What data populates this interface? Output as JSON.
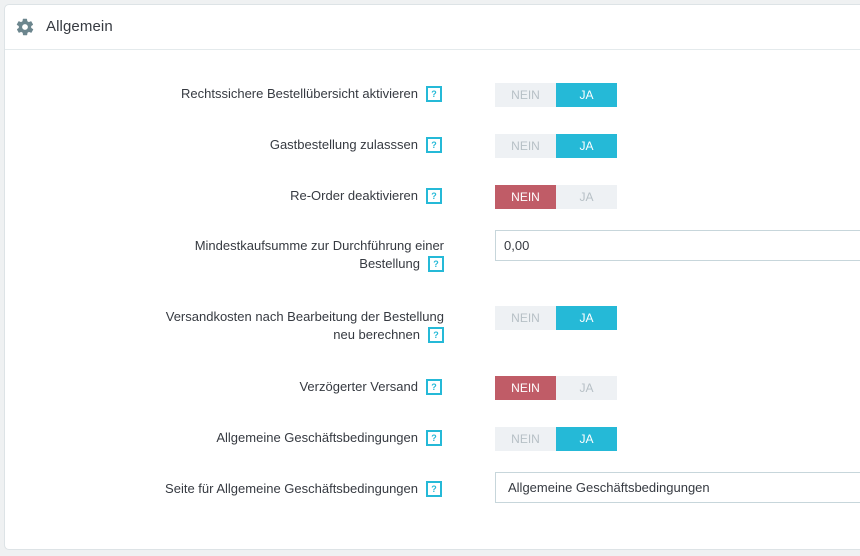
{
  "panel": {
    "title": "Allgemein",
    "icon": "gear-icon"
  },
  "help_mark": "?",
  "rows": [
    {
      "label": "Rechtssichere Bestellübersicht aktivieren",
      "type": "switch",
      "off": "NEIN",
      "on": "JA",
      "value": "JA"
    },
    {
      "label": "Gastbestellung zulasssen",
      "type": "switch",
      "off": "NEIN",
      "on": "JA",
      "value": "JA"
    },
    {
      "label": "Re-Order deaktivieren",
      "type": "switch",
      "off": "NEIN",
      "on": "JA",
      "value": "NEIN"
    },
    {
      "label_line1": "Mindestkaufsumme zur Durchführung einer",
      "label_line2": "Bestellung",
      "type": "input",
      "value": "0,00"
    },
    {
      "label_line1": "Versandkosten nach Bearbeitung der Bestellung",
      "label_line2": "neu berechnen",
      "type": "switch",
      "off": "NEIN",
      "on": "JA",
      "value": "JA"
    },
    {
      "label": "Verzögerter Versand",
      "type": "switch",
      "off": "NEIN",
      "on": "JA",
      "value": "NEIN"
    },
    {
      "label": "Allgemeine Geschäftsbedingungen",
      "type": "switch",
      "off": "NEIN",
      "on": "JA",
      "value": "JA"
    },
    {
      "label": "Seite für Allgemeine Geschäftsbedingungen",
      "type": "select",
      "value": "Allgemeine Geschäftsbedingungen"
    }
  ],
  "colors": {
    "accent": "#25b9d7",
    "danger": "#c05c67",
    "off": "#eef1f4"
  }
}
